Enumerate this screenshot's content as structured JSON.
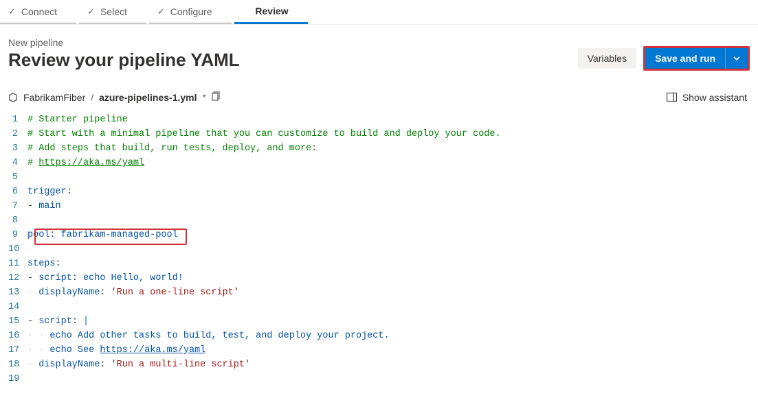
{
  "wizard": {
    "steps": [
      {
        "label": "Connect"
      },
      {
        "label": "Select"
      },
      {
        "label": "Configure"
      },
      {
        "label": "Review"
      }
    ],
    "active_index": 3
  },
  "header": {
    "subtitle": "New pipeline",
    "title": "Review your pipeline YAML",
    "variables_label": "Variables",
    "save_run_label": "Save and run"
  },
  "filebar": {
    "repo": "FabrikamFiber",
    "sep": "/",
    "file": "azure-pipelines-1.yml",
    "dirty_marker": "*",
    "show_assistant": "Show assistant"
  },
  "code": {
    "lines": [
      {
        "n": 1,
        "segs": [
          {
            "c": "c-comment",
            "t": "# Starter pipeline"
          }
        ]
      },
      {
        "n": 2,
        "segs": [
          {
            "c": "c-comment",
            "t": "# Start with a minimal pipeline that you can customize to build and deploy your code."
          }
        ]
      },
      {
        "n": 3,
        "segs": [
          {
            "c": "c-comment",
            "t": "# Add steps that build, run tests, deploy, and more:"
          }
        ]
      },
      {
        "n": 4,
        "segs": [
          {
            "c": "c-comment",
            "t": "# "
          },
          {
            "c": "c-url",
            "t": "https://aka.ms/yaml"
          }
        ]
      },
      {
        "n": 5,
        "segs": []
      },
      {
        "n": 6,
        "segs": [
          {
            "c": "c-key",
            "t": "trigger"
          },
          {
            "c": "",
            "t": ":"
          }
        ]
      },
      {
        "n": 7,
        "segs": [
          {
            "c": "",
            "t": "- "
          },
          {
            "c": "c-val",
            "t": "main"
          }
        ]
      },
      {
        "n": 8,
        "segs": []
      },
      {
        "n": 9,
        "segs": [
          {
            "c": "c-key",
            "t": "pool"
          },
          {
            "c": "",
            "t": ": "
          },
          {
            "c": "c-val",
            "t": "fabrikam-managed-pool"
          }
        ]
      },
      {
        "n": 10,
        "segs": []
      },
      {
        "n": 11,
        "segs": [
          {
            "c": "c-key",
            "t": "steps"
          },
          {
            "c": "",
            "t": ":"
          }
        ]
      },
      {
        "n": 12,
        "segs": [
          {
            "c": "",
            "t": "- "
          },
          {
            "c": "c-key",
            "t": "script"
          },
          {
            "c": "",
            "t": ": "
          },
          {
            "c": "c-val",
            "t": "echo Hello, world!"
          }
        ]
      },
      {
        "n": 13,
        "segs": [
          {
            "c": "guide",
            "t": "· "
          },
          {
            "c": "c-key",
            "t": "displayName"
          },
          {
            "c": "",
            "t": ": "
          },
          {
            "c": "c-str",
            "t": "'Run a one-line script'"
          }
        ]
      },
      {
        "n": 14,
        "segs": []
      },
      {
        "n": 15,
        "segs": [
          {
            "c": "",
            "t": "- "
          },
          {
            "c": "c-key",
            "t": "script"
          },
          {
            "c": "",
            "t": ": "
          },
          {
            "c": "c-val",
            "t": "|"
          }
        ]
      },
      {
        "n": 16,
        "segs": [
          {
            "c": "guide",
            "t": "· · "
          },
          {
            "c": "c-val",
            "t": "echo Add other tasks to build, test, and deploy your project."
          }
        ]
      },
      {
        "n": 17,
        "segs": [
          {
            "c": "guide",
            "t": "· · "
          },
          {
            "c": "c-val",
            "t": "echo See "
          },
          {
            "c": "c-url2",
            "t": "https://aka.ms/yaml"
          }
        ]
      },
      {
        "n": 18,
        "segs": [
          {
            "c": "guide",
            "t": "· "
          },
          {
            "c": "c-key",
            "t": "displayName"
          },
          {
            "c": "",
            "t": ": "
          },
          {
            "c": "c-str",
            "t": "'Run a multi-line script'"
          }
        ]
      },
      {
        "n": 19,
        "segs": []
      }
    ]
  },
  "highlight": {
    "pool_line": 9
  }
}
